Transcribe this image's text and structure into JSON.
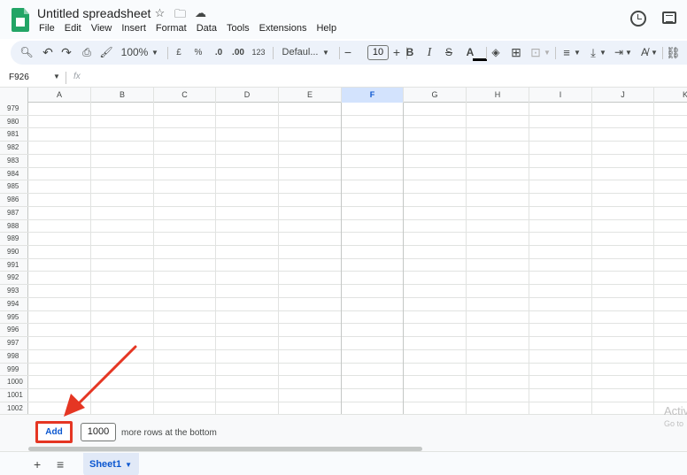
{
  "header": {
    "title": "Untitled spreadsheet",
    "menu": [
      "File",
      "Edit",
      "View",
      "Insert",
      "Format",
      "Data",
      "Tools",
      "Extensions",
      "Help"
    ]
  },
  "toolbar": {
    "zoom": "100%",
    "currency": "£",
    "percent": "%",
    "decrease_decimal": ".0",
    "increase_decimal": ".00",
    "number_format": "123",
    "font": "Defaul...",
    "font_size": "10",
    "minus": "−",
    "plus": "+",
    "bold": "B",
    "italic": "I",
    "strike": "S",
    "text_color": "A"
  },
  "formula_bar": {
    "name_box": "F926",
    "fx": "fx"
  },
  "grid": {
    "columns": [
      "A",
      "B",
      "C",
      "D",
      "E",
      "F",
      "G",
      "H",
      "I",
      "J",
      "K"
    ],
    "selected_column": "F",
    "rows": [
      "979",
      "980",
      "981",
      "982",
      "983",
      "984",
      "985",
      "986",
      "987",
      "988",
      "989",
      "990",
      "991",
      "992",
      "993",
      "994",
      "995",
      "996",
      "997",
      "998",
      "999",
      "1000",
      "1001",
      "1002"
    ]
  },
  "add_rows": {
    "button_label": "Add",
    "count": "1000",
    "label": "more rows at the bottom",
    "watermark_title": "Activ",
    "watermark_sub": "Go to"
  },
  "sheets": {
    "tabs": [
      "Sheet1"
    ]
  },
  "colors": {
    "accent": "#0b57d0",
    "highlight_box": "#e53623",
    "sheets_green": "#23a566"
  }
}
